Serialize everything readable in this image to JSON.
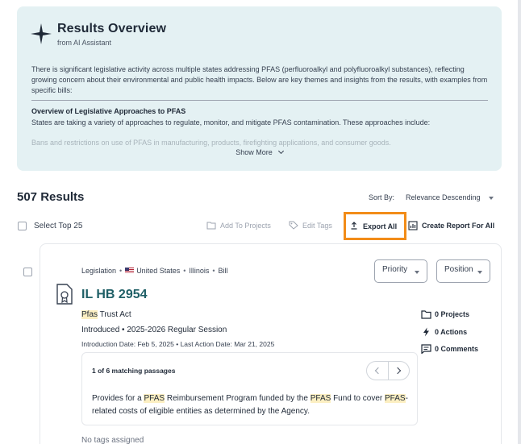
{
  "overview": {
    "title": "Results Overview",
    "subtitle": "from AI Assistant",
    "intro": "There is significant legislative activity across multiple states addressing PFAS (perfluoroalkyl and polyfluoroalkyl substances), reflecting growing concern about their environmental and public health impacts. Below are key themes and insights from the results, with examples from specific bills:",
    "section_heading": "Overview of Legislative Approaches to PFAS",
    "section_text": "States are taking a variety of approaches to regulate, monitor, and mitigate PFAS contamination. These approaches include:",
    "faded_text": "Bans and restrictions on use of PFAS in manufacturing, products, firefighting applications, and consumer goods.",
    "show_more": "Show More"
  },
  "results": {
    "count": "507 Results",
    "sort_label": "Sort By:",
    "sort_value": "Relevance Descending"
  },
  "toolbar": {
    "select_top": "Select Top 25",
    "add_to_projects": "Add To Projects",
    "edit_tags": "Edit Tags",
    "export_all": "Export All",
    "create_report": "Create Report For All"
  },
  "card": {
    "type": "Legislation",
    "country": "United States",
    "state": "Illinois",
    "doc_kind": "Bill",
    "bill_id": "IL HB 2954",
    "name_highlight": "Pfas",
    "name_rest": " Trust Act",
    "status": "Introduced",
    "session": "2025-2026 Regular Session",
    "intro_date_label": "Introduction Date:",
    "intro_date": "Feb 5, 2025",
    "last_action_label": "Last Action Date:",
    "last_action_date": "Mar 21, 2025",
    "priority": "Priority",
    "position": "Position",
    "projects": "0 Projects",
    "actions": "0 Actions",
    "comments": "0 Comments",
    "passages_count": "1 of 6 matching passages",
    "passage": {
      "p1": "Provides for a ",
      "h1": "PFAS",
      "p2": " Reimbursement Program funded by the ",
      "h2": "PFAS",
      "p3": " Fund to cover ",
      "h3": "PFAS",
      "p4": "-related costs of eligible entities as determined by the Agency."
    },
    "tags": "No tags assigned"
  }
}
